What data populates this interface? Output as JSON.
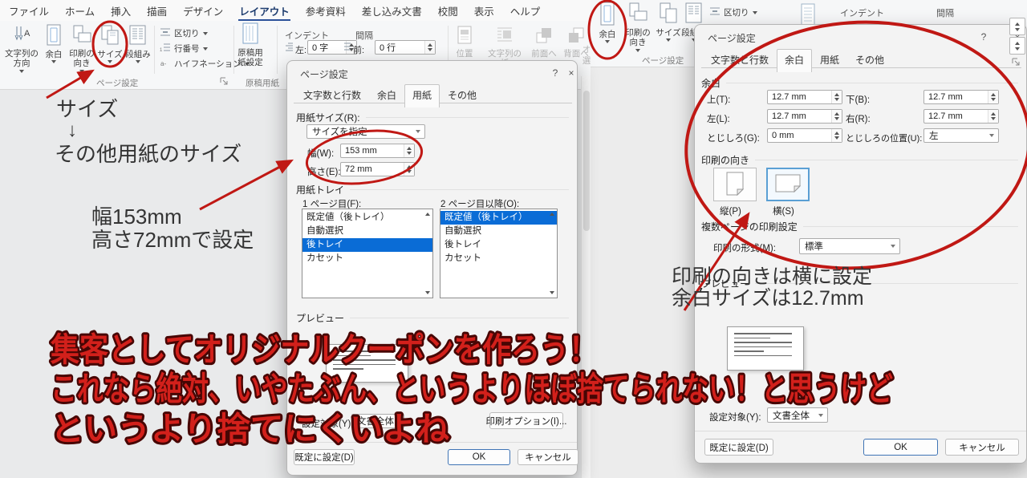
{
  "menubar": {
    "tabs": [
      "ファイル",
      "ホーム",
      "挿入",
      "描画",
      "デザイン",
      "レイアウト",
      "参考資料",
      "差し込み文書",
      "校閲",
      "表示",
      "ヘルプ"
    ]
  },
  "ribbon": {
    "text_direction": "文字列の方向",
    "margins": "余白",
    "orientation": "印刷の向き",
    "size": "サイズ",
    "columns": "段組み",
    "breaks": "区切り",
    "line_numbers": "行番号",
    "hyphenation": "ハイフネーション",
    "manuscript_setup": "原稿用紙設定",
    "indent_label": "インデント",
    "indent_left_label": "左:",
    "indent_left_value": "0 字",
    "spacing_label": "間隔",
    "spacing_before_label": "前:",
    "spacing_before_value": "0 行",
    "position": "位置",
    "text_wrap": "文字列の折",
    "bring_forward": "前面へ",
    "send_backward": "背面へ",
    "objects_partial_1": "オ",
    "objects_partial_2": "選",
    "page_setup_group": "ページ設定",
    "manuscript_group": "原稿用紙"
  },
  "paper_dialog": {
    "title": "ページ設定",
    "help_icon": "?",
    "tabs": [
      "文字数と行数",
      "余白",
      "用紙",
      "その他"
    ],
    "paper_size_label": "用紙サイズ(R):",
    "paper_size_value": "サイズを指定",
    "width_label": "幅(W):",
    "width_value": "153 mm",
    "height_label": "高さ(E):",
    "height_value": "72 mm",
    "tray_label": "用紙トレイ",
    "first_page_label": "1 ページ目(F):",
    "other_pages_label": "2 ページ目以降(O):",
    "tray_items": [
      "既定値（後トレイ）",
      "自動選択",
      "後トレイ",
      "カセット"
    ],
    "first_page_selected": "後トレイ",
    "other_pages_selected": "既定値（後トレイ）",
    "preview_label": "プレビュー",
    "apply_to_label": "設定対象(Y):",
    "apply_to_value": "文書全体",
    "print_options_button": "印刷オプション(I)...",
    "default_button": "既定に設定(D)",
    "ok_button": "OK",
    "cancel_button": "キャンセル"
  },
  "margins_dialog": {
    "title": "ページ設定",
    "help_icon": "?",
    "tabs": [
      "文字数と行数",
      "余白",
      "用紙",
      "その他"
    ],
    "margins_label": "余白",
    "top_label": "上(T):",
    "top_value": "12.7 mm",
    "bottom_label": "下(B):",
    "bottom_value": "12.7 mm",
    "left_label": "左(L):",
    "left_value": "12.7 mm",
    "right_label": "右(R):",
    "right_value": "12.7 mm",
    "gutter_label": "とじしろ(G):",
    "gutter_value": "0 mm",
    "gutter_position_label": "とじしろの位置(U):",
    "gutter_position_value": "左",
    "orientation_label": "印刷の向き",
    "portrait_label": "縦(P)",
    "landscape_label": "横(S)",
    "multipage_label": "複数ページの印刷設定",
    "print_format_label": "印刷の形式(M):",
    "print_format_value": "標準",
    "preview_label": "プレビュー",
    "apply_to_label": "設定対象(Y):",
    "apply_to_value": "文書全体",
    "default_button": "既定に設定(D)",
    "ok_button": "OK",
    "cancel_button": "キャンセル"
  },
  "annotations": {
    "size_step_1": "サイズ",
    "size_step_arrow": "↓",
    "size_step_2": "その他用紙のサイズ",
    "dimensions_note_1": "幅153mm",
    "dimensions_note_2": "高さ72mmで設定",
    "margin_note_1": "印刷の向きは横に設定",
    "margin_note_2": "余白サイズは12.7mm",
    "headline_1": "集客としてオリジナルクーポンを作ろう！",
    "headline_2": "これなら絶対、いやたぶん、というよりほぼ捨てられない！と思うけど",
    "headline_3": "というより捨てにくいよね"
  },
  "colors": {
    "annotation_red": "#c01814",
    "headline_fill": "#d2201b",
    "headline_stroke": "#470604",
    "selection_blue": "#0a6cd6",
    "word_accent": "#2b5199"
  }
}
